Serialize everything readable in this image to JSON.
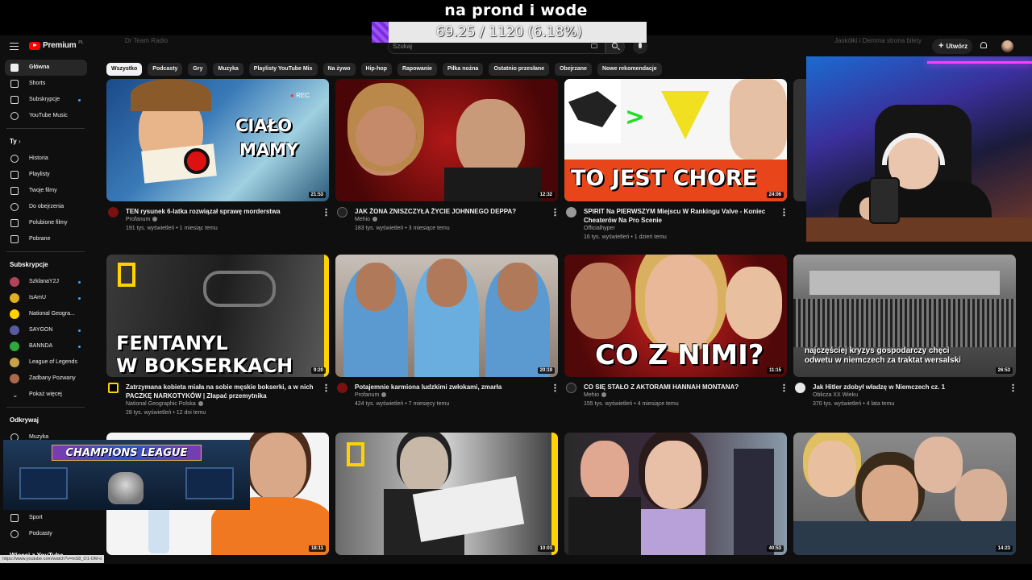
{
  "overlay": {
    "title": "na prond i wode",
    "progress_text": "69.25 / 1120 (6.18%)",
    "progress_fraction": 0.0618
  },
  "masthead": {
    "logo": "Premium",
    "logo_cc": "PL",
    "search_placeholder": "Szukaj",
    "create_label": "Utwórz",
    "ghost_left": "Dr Team Radio",
    "ghost_right": "Jaskółki i Demma strona bilety"
  },
  "colors": {
    "accent": "#ff0000",
    "progress": "#9d52ff",
    "link": "#3ea6ff"
  },
  "sidebar": {
    "main": [
      {
        "label": "Główna",
        "icon": "home-icon"
      },
      {
        "label": "Shorts",
        "icon": "shorts-icon"
      },
      {
        "label": "Subskrypcje",
        "icon": "subscriptions-icon"
      },
      {
        "label": "YouTube Music",
        "icon": "music-icon"
      }
    ],
    "you_header": "Ty",
    "you": [
      {
        "label": "Historia",
        "icon": "history-icon"
      },
      {
        "label": "Playlisty",
        "icon": "playlists-icon"
      },
      {
        "label": "Twoje filmy",
        "icon": "your-videos-icon"
      },
      {
        "label": "Do obejrzenia",
        "icon": "watch-later-icon"
      },
      {
        "label": "Polubione filmy",
        "icon": "liked-icon"
      },
      {
        "label": "Pobrane",
        "icon": "download-icon"
      }
    ],
    "subs_header": "Subskrypcje",
    "subs": [
      {
        "label": "SzklanaY2J",
        "color": "#b0455a"
      },
      {
        "label": "IsAmU",
        "color": "#e0b020"
      },
      {
        "label": "National Geogra...",
        "color": "#ffd200"
      },
      {
        "label": "SAYGON",
        "color": "#5a5aa0"
      },
      {
        "label": "BANNDA",
        "color": "#2faa3a"
      },
      {
        "label": "League of Legends",
        "color": "#c8a24a"
      },
      {
        "label": "Zadbany Pozwany",
        "color": "#a86a4a"
      }
    ],
    "show_more": "Pokaż więcej",
    "explore_header": "Odkrywaj",
    "explore": [
      {
        "label": "Muzyka",
        "icon": "music-note-icon"
      },
      {
        "label": "Sport",
        "icon": "trophy-icon"
      },
      {
        "label": "Podcasty",
        "icon": "podcast-icon"
      }
    ],
    "more_header": "Więcej z YouTube",
    "status_url": "https://www.youtube.com/watch?v=mS8_O1-OM-o"
  },
  "chips": [
    "Wszystko",
    "Podcasty",
    "Gry",
    "Muzyka",
    "Playlisty YouTube Mix",
    "Na żywo",
    "Hip-hop",
    "Rapowanie",
    "Piłka nożna",
    "Ostatnio przesłane",
    "Obejrzane",
    "Nowe rekomendacje"
  ],
  "videos": [
    {
      "title": "TEN rysunek 6-latka rozwiązał sprawę morderstwa",
      "channel": "Profanum",
      "stats": "191 tys. wyświetleń • 1 miesiąc temu",
      "duration": "21:53",
      "thumb_text": "CIAŁO\nMAMY",
      "rec": "REC"
    },
    {
      "title": "JAK ŻONA ZNISZCZYŁA ŻYCIE JOHNNEGO DEPPA?",
      "channel": "Mehio",
      "stats": "183 tys. wyświetleń • 3 miesiące temu",
      "duration": "12:32"
    },
    {
      "title": "SPIRIT Na PIERWSZYM Miejscu W Rankingu Valve - Koniec Cheaterów Na Pro Scenie",
      "channel": "Officialhyper",
      "stats": "16 tys. wyświetleń • 1 dzień temu",
      "duration": "24:06",
      "thumb_text": "TO JEST CHORE"
    },
    {
      "title": "Zatrzymana kobieta miała na sobie męskie bokserki, a w nich PACZKĘ NARKOTYKÓW | Złapać przemytnika",
      "channel": "National Geographic Polska",
      "stats": "28 tys. wyświetleń • 12 dni temu",
      "duration": "9:20",
      "thumb_text": "FENTANYL\nW BOKSERKACH"
    },
    {
      "title": "Potajemnie karmiona ludzkimi zwłokami, zmarła",
      "channel": "Profanum",
      "stats": "424 tys. wyświetleń • 7 miesięcy temu",
      "duration": "20:19"
    },
    {
      "title": "CO SIĘ STAŁO Z AKTORAMI HANNAH MONTANA?",
      "channel": "Mehio",
      "stats": "155 tys. wyświetleń • 4 miesiące temu",
      "duration": "11:15",
      "thumb_text": "CO Z NIMI?"
    },
    {
      "title": "Jak Hitler zdobył władzę w Niemczech cz. 1",
      "channel": "Oblicza XX Wieku",
      "stats": "370 tys. wyświetleń • 4 lata temu",
      "duration": "26:53",
      "thumb_text": "najczęściej kryzys gospodarczy chęci odwetu w niemczech za traktat wersalski"
    },
    {
      "duration": "18:11"
    },
    {
      "duration": "10:03"
    },
    {
      "duration": "40:53"
    },
    {
      "duration": "14:23"
    }
  ],
  "mini_player": {
    "banner": "CHAMPIONS LEAGUE"
  }
}
